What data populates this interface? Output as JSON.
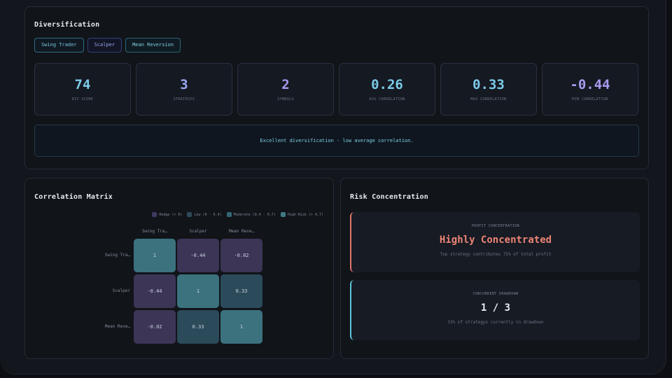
{
  "diversification": {
    "title": "Diversification",
    "tags": [
      "Swing Trader",
      "Scalper",
      "Mean Reversion"
    ],
    "stats": [
      {
        "value": "74",
        "label": "DIV SCORE",
        "color": "#7ccbe8"
      },
      {
        "value": "3",
        "label": "STRATEGYS",
        "color": "#9aa9f0"
      },
      {
        "value": "2",
        "label": "SYMBOLS",
        "color": "#a79af0"
      },
      {
        "value": "0.26",
        "label": "AVG CORRELATION",
        "color": "#7ccbe8"
      },
      {
        "value": "0.33",
        "label": "MAX CORRELATION",
        "color": "#7ccbe8"
      },
      {
        "value": "-0.44",
        "label": "MIN CORRELATION",
        "color": "#a79af0"
      }
    ],
    "note": "Excellent diversification - low average correlation."
  },
  "correlation": {
    "title": "Correlation Matrix",
    "legend": [
      {
        "label": "Hedge (< 0)",
        "color": "#413a60"
      },
      {
        "label": "Low (0 - 0.4)",
        "color": "#2c4a5a"
      },
      {
        "label": "Moderate (0.4 - 0.7)",
        "color": "#356676"
      },
      {
        "label": "High Risk (> 0.7)",
        "color": "#3e7a86"
      }
    ],
    "headers": [
      "Swing Tra…",
      "Scalper",
      "Mean Reve…"
    ],
    "rows": [
      {
        "label": "Swing Tra…",
        "cells": [
          "1",
          "-0.44",
          "-0.02"
        ]
      },
      {
        "label": "Scalper",
        "cells": [
          "-0.44",
          "1",
          "0.33"
        ]
      },
      {
        "label": "Mean Reve…",
        "cells": [
          "-0.02",
          "0.33",
          "1"
        ]
      }
    ],
    "cell_colors": [
      [
        "#3b727e",
        "#3d3556",
        "#3d3556"
      ],
      [
        "#3d3556",
        "#3b727e",
        "#2b4a5a"
      ],
      [
        "#3d3556",
        "#2b4a5a",
        "#3b727e"
      ]
    ]
  },
  "risk": {
    "title": "Risk Concentration",
    "profit": {
      "label": "PROFIT CONCENTRATION",
      "value": "Highly Concentrated",
      "sub": "Top strategy contributes 75% of total profit",
      "color": "#ea8474"
    },
    "drawdown": {
      "label": "CONCURRENT DRAWDOWN",
      "value": "1 / 3",
      "sub": "33% of strategys currently in drawdown",
      "color": "#e8ecf4"
    }
  }
}
